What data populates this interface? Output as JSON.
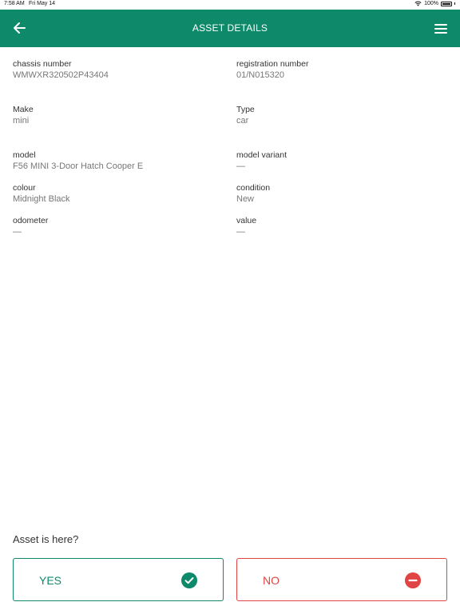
{
  "status_bar": {
    "time": "7:58 AM",
    "date": "Fri May 14",
    "battery": "100%"
  },
  "app_bar": {
    "title": "ASSET DETAILS",
    "back_icon": "arrow-left-icon",
    "menu_icon": "hamburger-menu-icon"
  },
  "fields": {
    "chassis_number": {
      "label": "chassis number",
      "value": "WMWXR320502P43404"
    },
    "registration_number": {
      "label": "registration number",
      "value": "01/N015320"
    },
    "make": {
      "label": "Make",
      "value": "mini"
    },
    "type": {
      "label": "Type",
      "value": "car"
    },
    "model": {
      "label": "model",
      "value": "F56 MINI 3-Door Hatch Cooper E"
    },
    "model_variant": {
      "label": "model variant",
      "value": "—"
    },
    "colour": {
      "label": "colour",
      "value": "Midnight Black"
    },
    "condition": {
      "label": "condition",
      "value": "New"
    },
    "odometer": {
      "label": "odometer",
      "value": "—"
    },
    "value": {
      "label": "value",
      "value": "—"
    }
  },
  "question": {
    "text": "Asset is here?",
    "yes_label": "YES",
    "no_label": "NO"
  },
  "colors": {
    "primary": "#0e8a6b",
    "danger": "#e04444"
  }
}
